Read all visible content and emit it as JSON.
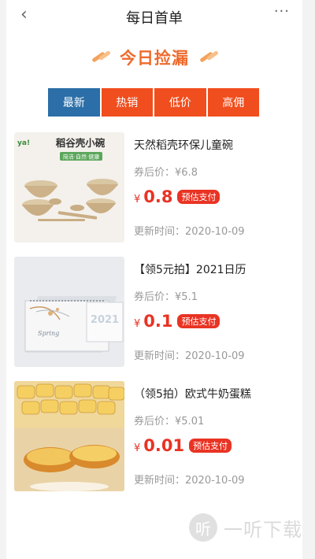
{
  "header": {
    "title": "每日首单",
    "back_icon": "‹",
    "more_icon": "···"
  },
  "banner": {
    "title": "今日捡漏"
  },
  "tabs": [
    {
      "label": "最新",
      "active": true
    },
    {
      "label": "热销",
      "active": false
    },
    {
      "label": "低价",
      "active": false
    },
    {
      "label": "高佣",
      "active": false
    }
  ],
  "products": [
    {
      "image_text": "稻谷壳小碗",
      "image_subtext": "简洁·自然·健康",
      "image_logo": "ya!",
      "name": "天然稻壳环保儿童碗",
      "coupon_label": "券后价：",
      "coupon_price": "¥6.8",
      "currency": "¥",
      "price": "0.8",
      "badge": "预估支付",
      "time_label": "更新时间：",
      "time": "2020-10-09"
    },
    {
      "image_text": "2021",
      "name": "【领5元拍】2021日历",
      "coupon_label": "券后价：",
      "coupon_price": "¥5.1",
      "currency": "¥",
      "price": "0.1",
      "badge": "预估支付",
      "time_label": "更新时间：",
      "time": "2020-10-09"
    },
    {
      "name": "（领5拍）欧式牛奶蛋糕",
      "coupon_label": "券后价：",
      "coupon_price": "¥5.01",
      "currency": "¥",
      "price": "0.01",
      "badge": "预估支付",
      "time_label": "更新时间：",
      "time": "2020-10-09"
    }
  ],
  "watermark": {
    "icon": "听",
    "text": "一听下载"
  },
  "colors": {
    "accent": "#f04e1e",
    "active_tab": "#2b6ea8",
    "price": "#e93323",
    "banner": "#ee6a2d"
  }
}
